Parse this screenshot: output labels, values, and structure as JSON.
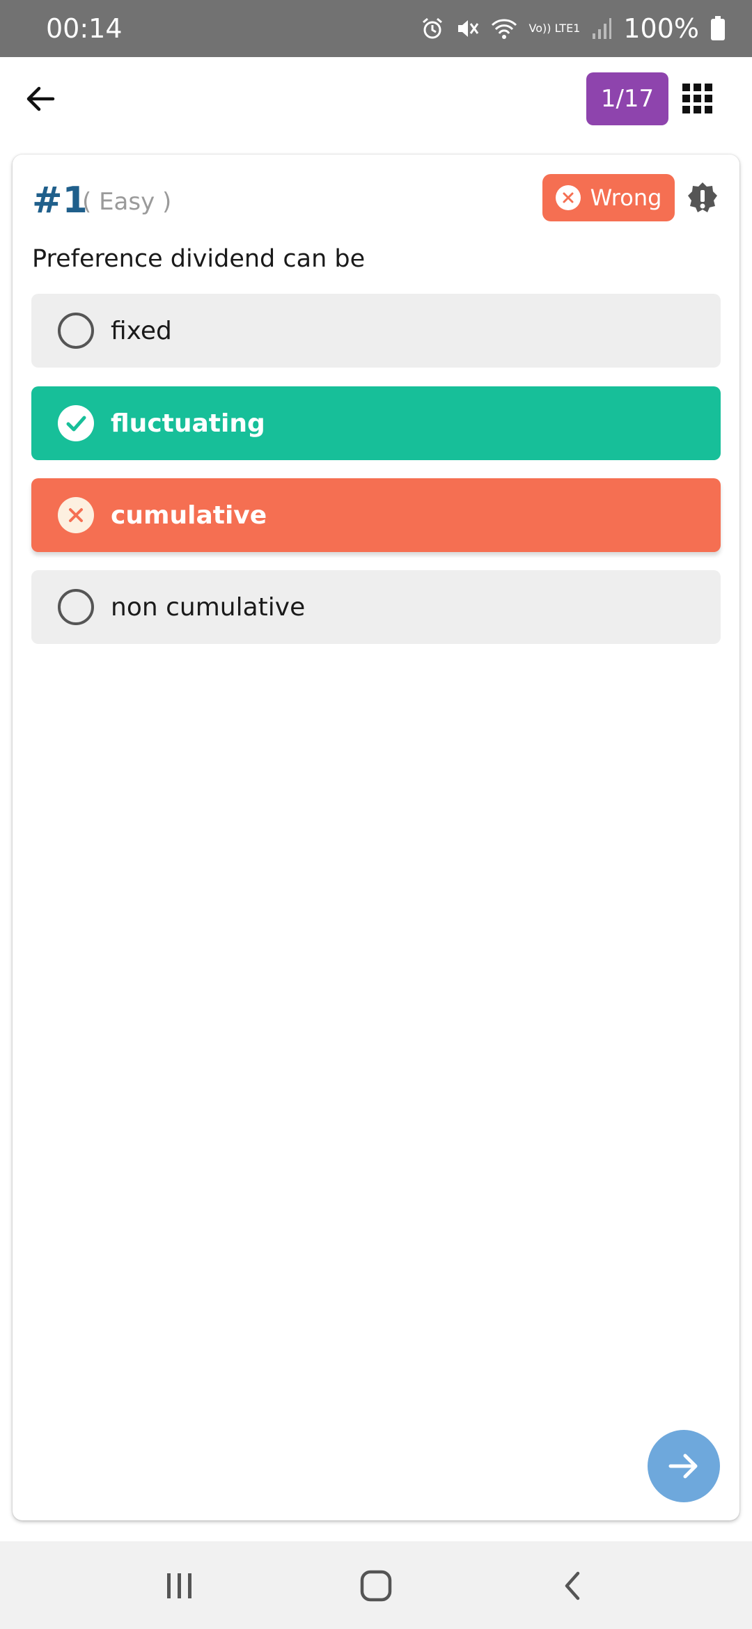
{
  "status_bar": {
    "time": "00:14",
    "battery": "100%",
    "network": "Vo)) LTE1",
    "icons": [
      "alarm-icon",
      "mute-icon",
      "wifi-icon",
      "signal-icon",
      "battery-icon"
    ]
  },
  "app_bar": {
    "progress": "1/17",
    "progress_color": "#8e44ad"
  },
  "question": {
    "number": "#1",
    "difficulty": "( Easy )",
    "result": "Wrong",
    "text": "Preference dividend can be"
  },
  "options": [
    {
      "label": "fixed",
      "state": "unselected"
    },
    {
      "label": "fluctuating",
      "state": "correct"
    },
    {
      "label": "cumulative",
      "state": "wrong"
    },
    {
      "label": "non cumulative",
      "state": "unselected"
    }
  ],
  "colors": {
    "correct": "#17bf99",
    "wrong": "#f56f52",
    "next": "#6ea8dc",
    "question_number": "#1f5f8b"
  }
}
